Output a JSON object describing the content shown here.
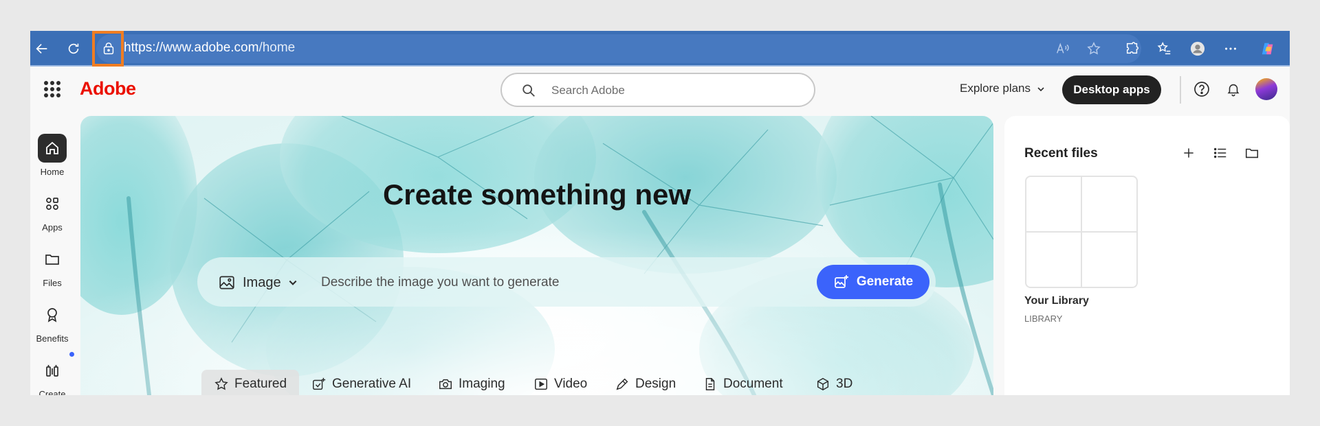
{
  "browser": {
    "url_main": "https://www.adobe.com",
    "url_path": "/home",
    "accent": "#3b6fb6",
    "highlight": "#f07d22"
  },
  "header": {
    "logo": "Adobe",
    "search_placeholder": "Search Adobe",
    "explore_label": "Explore plans",
    "desktop_apps_label": "Desktop apps"
  },
  "nav": {
    "items": [
      {
        "label": "Home",
        "icon": "home-icon"
      },
      {
        "label": "Apps",
        "icon": "apps-icon"
      },
      {
        "label": "Files",
        "icon": "folder-icon"
      },
      {
        "label": "Benefits",
        "icon": "award-icon"
      },
      {
        "label": "Create",
        "icon": "create-icon"
      }
    ]
  },
  "hero": {
    "title": "Create something new",
    "type_label": "Image",
    "prompt_placeholder": "Describe the image you want to generate",
    "generate_label": "Generate",
    "generate_color": "#3b63fb"
  },
  "tabs": [
    {
      "label": "Featured",
      "icon": "star-icon"
    },
    {
      "label": "Generative AI",
      "icon": "sparkle-icon"
    },
    {
      "label": "Imaging",
      "icon": "camera-icon"
    },
    {
      "label": "Video",
      "icon": "play-icon"
    },
    {
      "label": "Design",
      "icon": "pen-icon"
    },
    {
      "label": "Document",
      "icon": "document-icon"
    },
    {
      "label": "3D",
      "icon": "cube-icon"
    }
  ],
  "recent": {
    "title": "Recent files",
    "library_name": "Your Library",
    "library_type": "LIBRARY"
  }
}
